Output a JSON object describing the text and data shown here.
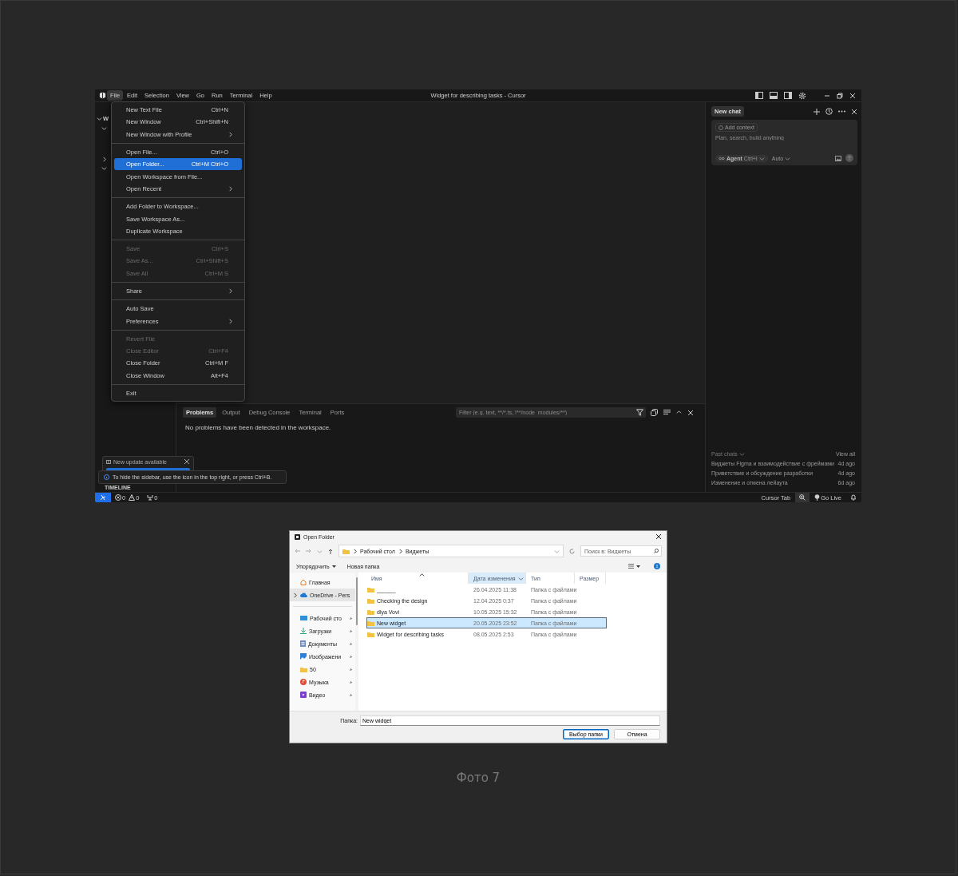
{
  "window": {
    "title": "Widget for describing tasks - Cursor"
  },
  "menu_bar": [
    {
      "label": "File",
      "selected": true
    },
    {
      "label": "Edit",
      "selected": false
    },
    {
      "label": "Selection",
      "selected": false
    },
    {
      "label": "View",
      "selected": false
    },
    {
      "label": "Go",
      "selected": false
    },
    {
      "label": "Run",
      "selected": false
    },
    {
      "label": "Terminal",
      "selected": false
    },
    {
      "label": "Help",
      "selected": false
    }
  ],
  "file_menu": {
    "groups": [
      [
        {
          "label": "New Text File",
          "shortcut": "Ctrl+N",
          "submenu": false,
          "disabled": false,
          "selected": false
        },
        {
          "label": "New Window",
          "shortcut": "Ctrl+Shift+N",
          "submenu": false,
          "disabled": false,
          "selected": false
        },
        {
          "label": "New Window with Profile",
          "submenu": true,
          "disabled": false,
          "selected": false
        }
      ],
      [
        {
          "label": "Open File...",
          "shortcut": "Ctrl+O",
          "submenu": false,
          "disabled": false,
          "selected": false
        },
        {
          "label": "Open Folder...",
          "shortcut": "Ctrl+M Ctrl+O",
          "submenu": false,
          "disabled": false,
          "selected": true
        },
        {
          "label": "Open Workspace from File...",
          "submenu": false,
          "disabled": false,
          "selected": false
        },
        {
          "label": "Open Recent",
          "submenu": true,
          "disabled": false,
          "selected": false
        }
      ],
      [
        {
          "label": "Add Folder to Workspace...",
          "submenu": false,
          "disabled": false,
          "selected": false
        },
        {
          "label": "Save Workspace As...",
          "submenu": false,
          "disabled": false,
          "selected": false
        },
        {
          "label": "Duplicate Workspace",
          "submenu": false,
          "disabled": false,
          "selected": false
        }
      ],
      [
        {
          "label": "Save",
          "shortcut": "Ctrl+S",
          "submenu": false,
          "disabled": true,
          "selected": false
        },
        {
          "label": "Save As...",
          "shortcut": "Ctrl+Shift+S",
          "submenu": false,
          "disabled": true,
          "selected": false
        },
        {
          "label": "Save All",
          "shortcut": "Ctrl+M S",
          "submenu": false,
          "disabled": true,
          "selected": false
        }
      ],
      [
        {
          "label": "Share",
          "submenu": true,
          "disabled": false,
          "selected": false
        }
      ],
      [
        {
          "label": "Auto Save",
          "submenu": false,
          "disabled": false,
          "selected": false
        },
        {
          "label": "Preferences",
          "submenu": true,
          "disabled": false,
          "selected": false
        }
      ],
      [
        {
          "label": "Revert File",
          "submenu": false,
          "disabled": true,
          "selected": false
        },
        {
          "label": "Close Editor",
          "shortcut": "Ctrl+F4",
          "submenu": false,
          "disabled": true,
          "selected": false
        },
        {
          "label": "Close Folder",
          "shortcut": "Ctrl+M F",
          "submenu": false,
          "disabled": false,
          "selected": false
        },
        {
          "label": "Close Window",
          "shortcut": "Alt+F4",
          "submenu": false,
          "disabled": false,
          "selected": false
        }
      ],
      [
        {
          "label": "Exit",
          "submenu": false,
          "disabled": false,
          "selected": false
        }
      ]
    ]
  },
  "sidebar": {
    "heading": "W",
    "timeline": "TIMELINE"
  },
  "panel": {
    "tabs": [
      {
        "label": "Problems",
        "selected": true
      },
      {
        "label": "Output",
        "selected": false
      },
      {
        "label": "Debug Console",
        "selected": false
      },
      {
        "label": "Terminal",
        "selected": false
      },
      {
        "label": "Ports",
        "selected": false
      }
    ],
    "filter": {
      "placeholder": "Filter (e.g. text, **/*.ts, !**/node_modules/**)"
    },
    "message": "No problems have been detected in the workspace."
  },
  "chat": {
    "tab": "New chat",
    "add_context": "Add context",
    "placeholder": "Plan, search, build anything",
    "mode": "Agent",
    "mode_shortcut": "Ctrl+I",
    "model": "Auto",
    "past_chats_label": "Past chats",
    "view_all": "View all",
    "past_chats": [
      {
        "title": "Виджеты Figma и взаимодействие с фреймами",
        "age": "4d ago"
      },
      {
        "title": "Приветствие и обсуждение разработки",
        "age": "4d ago"
      },
      {
        "title": "Изменение и отмена лейаута",
        "age": "6d ago"
      }
    ]
  },
  "notifications": {
    "update": "New update available",
    "tip": "To hide the sidebar, use the icon in the top right, or press Ctrl+B."
  },
  "status_bar": {
    "errors": "0",
    "warnings": "0",
    "ports": "0",
    "cursor_tab": "Cursor Tab",
    "go_live": "Go Live"
  },
  "dialog": {
    "title": "Open Folder",
    "breadcrumb": [
      "Рабочий стол",
      "Виджеты"
    ],
    "search": {
      "placeholder": "Поиск в: Виджеты"
    },
    "toolbar": [
      "Упорядочить",
      "Новая папка"
    ],
    "nav": [
      {
        "label": "Главная",
        "kind": "home",
        "pinned": false,
        "expandable": false,
        "selected": false
      },
      {
        "label": "OneDrive - Pers",
        "kind": "cloud",
        "pinned": false,
        "expandable": true,
        "selected": true
      },
      {
        "label": "Рабочий сто",
        "kind": "desktop",
        "pinned": true,
        "expandable": false,
        "selected": false
      },
      {
        "label": "Загрузки",
        "kind": "download",
        "pinned": true,
        "expandable": false,
        "selected": false
      },
      {
        "label": "Документы",
        "kind": "documents",
        "pinned": true,
        "expandable": false,
        "selected": false
      },
      {
        "label": "Изображени",
        "kind": "pictures",
        "pinned": true,
        "expandable": false,
        "selected": false
      },
      {
        "label": "50",
        "kind": "folder",
        "pinned": true,
        "expandable": false,
        "selected": false
      },
      {
        "label": "Музыка",
        "kind": "music",
        "pinned": true,
        "expandable": false,
        "selected": false
      },
      {
        "label": "Видео",
        "kind": "video",
        "pinned": true,
        "expandable": false,
        "selected": false
      }
    ],
    "columns": [
      {
        "label": "Имя",
        "selected": false
      },
      {
        "label": "Дата изменения",
        "selected": true
      },
      {
        "label": "Тип",
        "selected": false
      },
      {
        "label": "Размер",
        "selected": false
      }
    ],
    "rows": [
      {
        "name": "______",
        "date": "26.04.2025 11:38",
        "type": "Папка с файлами",
        "selected": false
      },
      {
        "name": "Checking the design",
        "date": "12.04.2025 0:37",
        "type": "Папка с файлами",
        "selected": false
      },
      {
        "name": "dlya Vovi",
        "date": "10.05.2025 15:32",
        "type": "Папка с файлами",
        "selected": false
      },
      {
        "name": "New widget",
        "date": "20.05.2025 23:52",
        "type": "Папка с файлами",
        "selected": true
      },
      {
        "name": "Widget for describing tasks",
        "date": "08.05.2025 2:53",
        "type": "Папка с файлами",
        "selected": false
      }
    ],
    "folder_label": "Папка:",
    "folder_value": "New widget",
    "buttons": [
      "Выбор папки",
      "Отмена"
    ]
  },
  "caption": "Фото 7"
}
